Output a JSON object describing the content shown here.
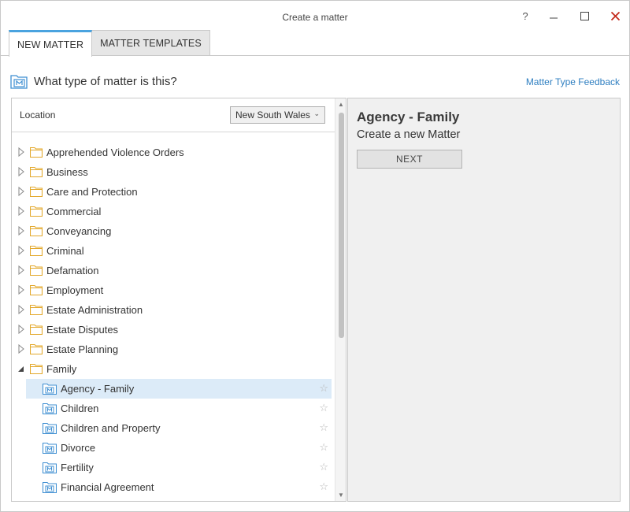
{
  "window": {
    "title": "Create a matter",
    "help_label": "?",
    "minimize_label": "—",
    "maximize_label": "☐",
    "close_label": "✕",
    "close_color": "#c42b1c"
  },
  "tabs": [
    {
      "label": "NEW MATTER",
      "active": true
    },
    {
      "label": "MATTER TEMPLATES",
      "active": false
    }
  ],
  "accent_color": "#4aa3df",
  "link_color": "#2f7fc1",
  "heading": {
    "text": "What type of matter is this?",
    "icon": "matter-icon",
    "feedback_link": "Matter Type Feedback"
  },
  "location": {
    "label": "Location",
    "selected": "New South Wales"
  },
  "tree": {
    "folders": [
      {
        "label": "Apprehended Violence Orders",
        "expanded": false
      },
      {
        "label": "Business",
        "expanded": false
      },
      {
        "label": "Care and Protection",
        "expanded": false
      },
      {
        "label": "Commercial",
        "expanded": false
      },
      {
        "label": "Conveyancing",
        "expanded": false
      },
      {
        "label": "Criminal",
        "expanded": false
      },
      {
        "label": "Defamation",
        "expanded": false
      },
      {
        "label": "Employment",
        "expanded": false
      },
      {
        "label": "Estate Administration",
        "expanded": false
      },
      {
        "label": "Estate Disputes",
        "expanded": false
      },
      {
        "label": "Estate Planning",
        "expanded": false
      },
      {
        "label": "Family",
        "expanded": true
      }
    ],
    "family_children": [
      {
        "label": "Agency - Family",
        "selected": true
      },
      {
        "label": "Children",
        "selected": false
      },
      {
        "label": "Children and Property",
        "selected": false
      },
      {
        "label": "Divorce",
        "selected": false
      },
      {
        "label": "Fertility",
        "selected": false
      },
      {
        "label": "Financial Agreement",
        "selected": false
      }
    ]
  },
  "detail": {
    "title": "Agency - Family",
    "subtitle": "Create a new Matter",
    "next_label": "NEXT"
  }
}
